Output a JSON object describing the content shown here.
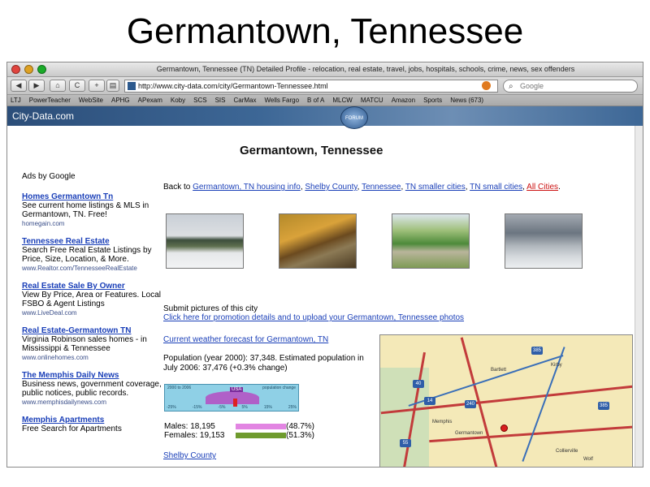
{
  "slide": {
    "title": "Germantown, Tennessee"
  },
  "browser": {
    "window_title": "Germantown, Tennessee (TN) Detailed Profile - relocation, real estate, travel, jobs, hospitals, schools, crime, news, sex offenders",
    "url": "http://www.city-data.com/city/Germantown-Tennessee.html",
    "search_placeholder": "Google",
    "bookmarks": [
      "LTJ",
      "PowerTeacher",
      "WebSite",
      "APHG",
      "APexam",
      "Koby",
      "SCS",
      "SIS",
      "CarMax",
      "Wells Fargo",
      "B of A",
      "MLCW",
      "MATCU",
      "Amazon",
      "Sports",
      "News (673)"
    ],
    "nav_back": "◀",
    "nav_forward": "▶",
    "nav_home": "⌂",
    "nav_reload": "C",
    "nav_add": "+"
  },
  "site": {
    "logo": "City-Data.com",
    "forum_badge": "FORUM"
  },
  "page": {
    "heading": "Germantown, Tennessee",
    "ads_label": "Ads by Google",
    "ads": [
      {
        "title": "Homes Germantown Tn",
        "body": "See current home listings & MLS in Germantown, TN. Free!",
        "url": "homegain.com"
      },
      {
        "title": "Tennessee Real Estate",
        "body": "Search Free Real Estate Listings by Price, Size, Location, & More.",
        "url": "www.Realtor.com/TennesseeRealEstate"
      },
      {
        "title": "Real Estate Sale By Owner",
        "body": "View By Price, Area or Features. Local FSBO & Agent Listings",
        "url": "www.LiveDeal.com"
      },
      {
        "title": "Real Estate-Germantown TN",
        "body": "Virginia Robinson sales homes - in Mississippi & Tennessee",
        "url": "www.onlinehomes.com"
      },
      {
        "title": "The Memphis Daily News",
        "body": "Business news, government coverage, public notices, public records.",
        "url": "www.memphisdailynews.com"
      },
      {
        "title": "Memphis Apartments",
        "body": "Free Search for Apartments",
        "url": ""
      }
    ],
    "backto": {
      "prefix": "Back to",
      "links": [
        "Germantown, TN housing info",
        "Shelby County",
        "Tennessee",
        "TN smaller cities",
        "TN small cities"
      ],
      "last": "All Cities",
      "sep": ", ",
      "end": "."
    },
    "submit": {
      "line1": "Submit pictures of this city",
      "line2": "Click here for promotion details and to upload your Germantown, Tennessee photos"
    },
    "weather_link": "Current weather forecast for Germantown, TN",
    "population": "Population (year 2000): 37,348. Estimated population in July 2006: 37,476 (+0.3% change)",
    "pop_graph": {
      "label_left": "2000 to 2006",
      "label_right": "population change",
      "usa_label": "USA",
      "ticks": [
        "-25%",
        "-15%",
        "-5%",
        "5%",
        "15%",
        "25%"
      ]
    },
    "gender": {
      "males_label": "Males: 18,195",
      "males_pct": "(48.7%)",
      "females_label": "Females: 19,153",
      "females_pct": "(51.3%)"
    },
    "shelby_link": "Shelby County",
    "map_labels": {
      "memphis": "Memphis",
      "germantown": "Germantown",
      "collierville": "Collierville",
      "i40": "40",
      "i240": "240",
      "i55": "55",
      "r14": "14",
      "r385": "385",
      "r385b": "385",
      "town_bartlett": "Bartlett",
      "town_kirby": "Kirby",
      "wolf": "Wolf"
    }
  }
}
